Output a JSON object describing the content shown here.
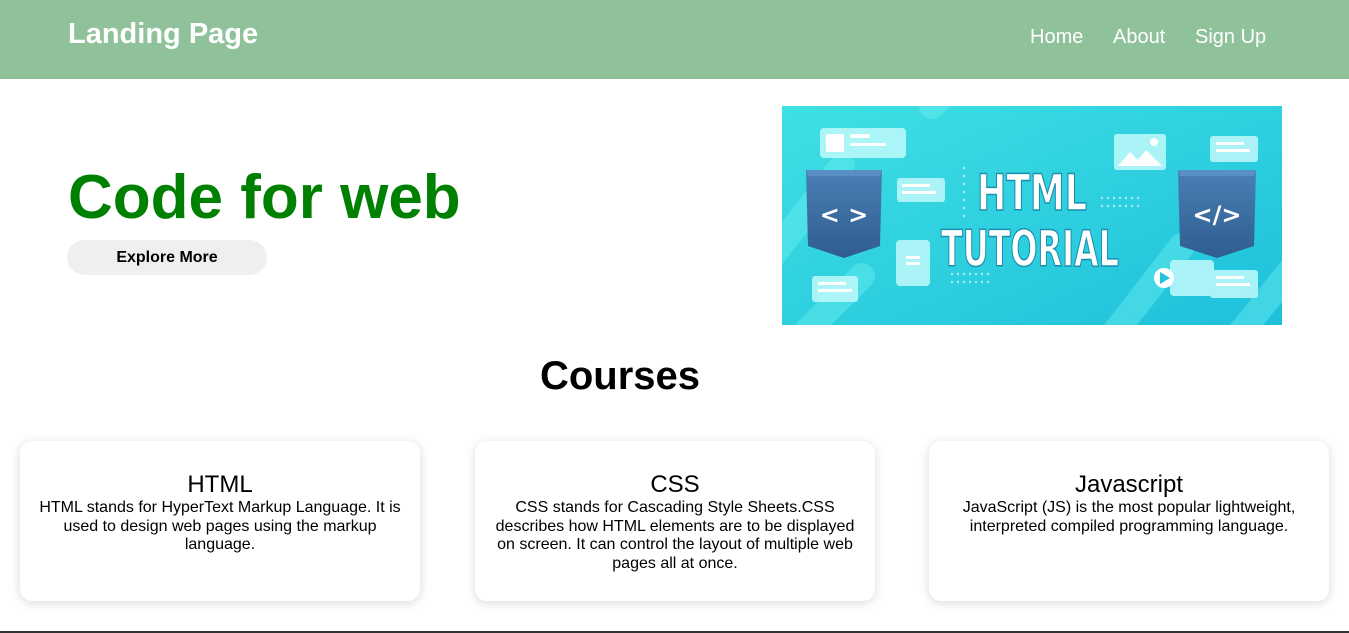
{
  "header": {
    "brand": "Landing Page",
    "nav": [
      "Home",
      "About",
      "Sign Up"
    ],
    "background": "#8fc29a"
  },
  "hero": {
    "title": "Code for web",
    "title_color": "#008000",
    "button_label": "Explore More",
    "image": {
      "heading_line1": "HTML",
      "heading_line2": "TUTORIAL",
      "left_badge": "< >",
      "right_badge": "</>"
    }
  },
  "courses": {
    "title": "Courses",
    "items": [
      {
        "title": "HTML",
        "description": "HTML stands for HyperText Markup Language. It is used to design web pages using the markup language."
      },
      {
        "title": "CSS",
        "description": "CSS stands for Cascading Style Sheets.CSS describes how HTML elements are to be displayed on screen. It can control the layout of multiple web pages all at once."
      },
      {
        "title": "Javascript",
        "description": "JavaScript (JS) is the most popular lightweight, interpreted compiled programming language."
      }
    ]
  }
}
